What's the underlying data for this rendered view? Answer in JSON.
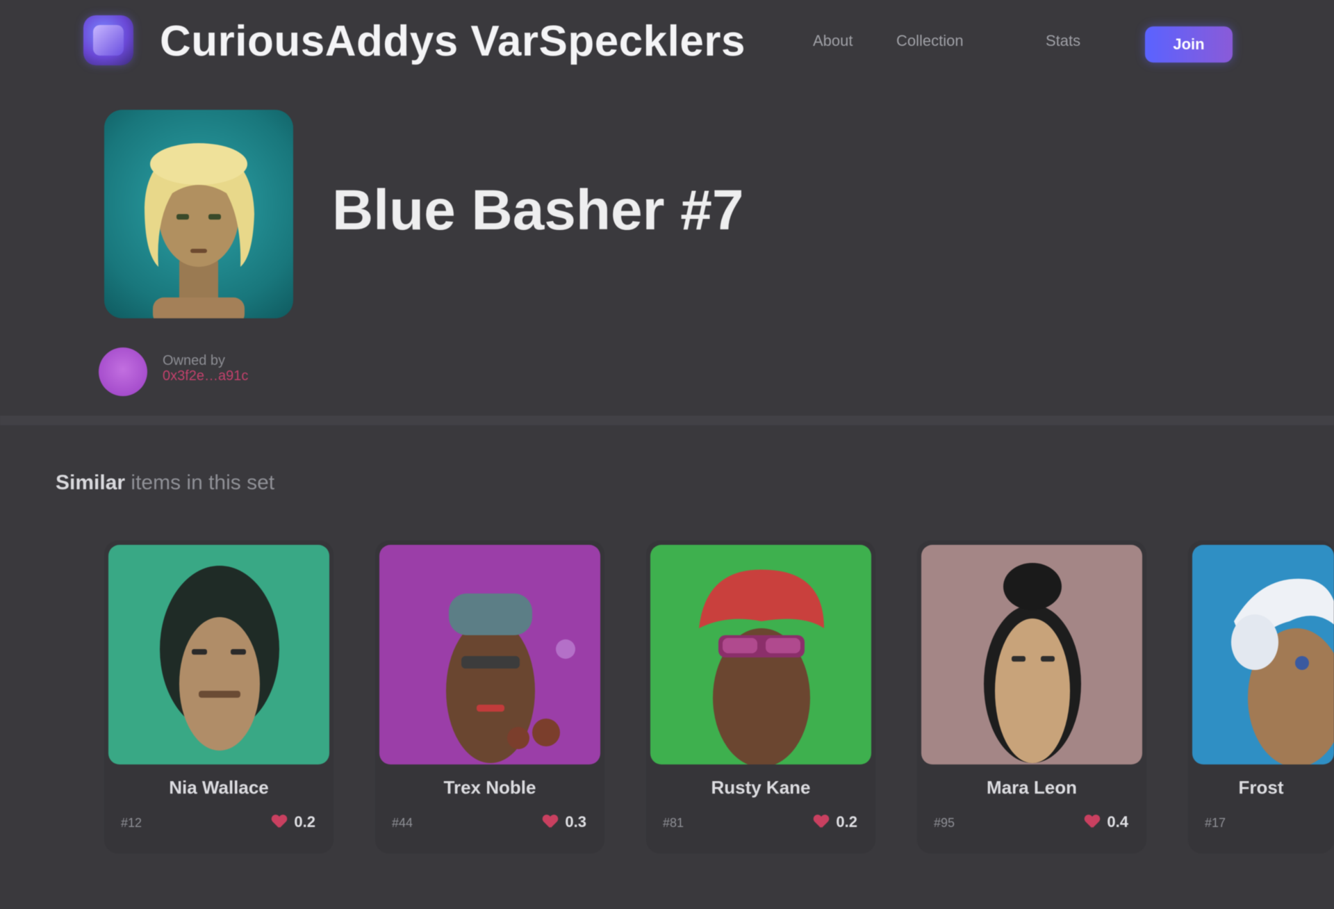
{
  "header": {
    "brand": "CuriousAddys VarSpecklers",
    "nav": [
      "About",
      "Collection",
      "Stats"
    ],
    "connect_label": "Join",
    "logo_icon": "planet-logo-icon"
  },
  "profile": {
    "title": "Blue Basher #7",
    "avatar_background": "#1f8d91",
    "owner_label": "Owned by",
    "owner_address": "0x3f2e…a91c"
  },
  "section": {
    "title": "Similar",
    "subtitle": "items in this set"
  },
  "cards": [
    {
      "name": "Nia Wallace",
      "meta": "#12",
      "price": "0.2",
      "bg": "#39a885"
    },
    {
      "name": "Trex Noble",
      "meta": "#44",
      "price": "0.3",
      "bg": "#9b3ea8"
    },
    {
      "name": "Rusty Kane",
      "meta": "#81",
      "price": "0.2",
      "bg": "#3eb04e"
    },
    {
      "name": "Mara Leon",
      "meta": "#95",
      "price": "0.4",
      "bg": "#a48686"
    },
    {
      "name": "Frost",
      "meta": "#17",
      "price": "",
      "bg": "#2f8fc4"
    }
  ],
  "colors": {
    "page_bg": "#3a393d",
    "accent_start": "#5a63ff",
    "accent_end": "#8a5bd8",
    "price_heart": "#c94060"
  }
}
